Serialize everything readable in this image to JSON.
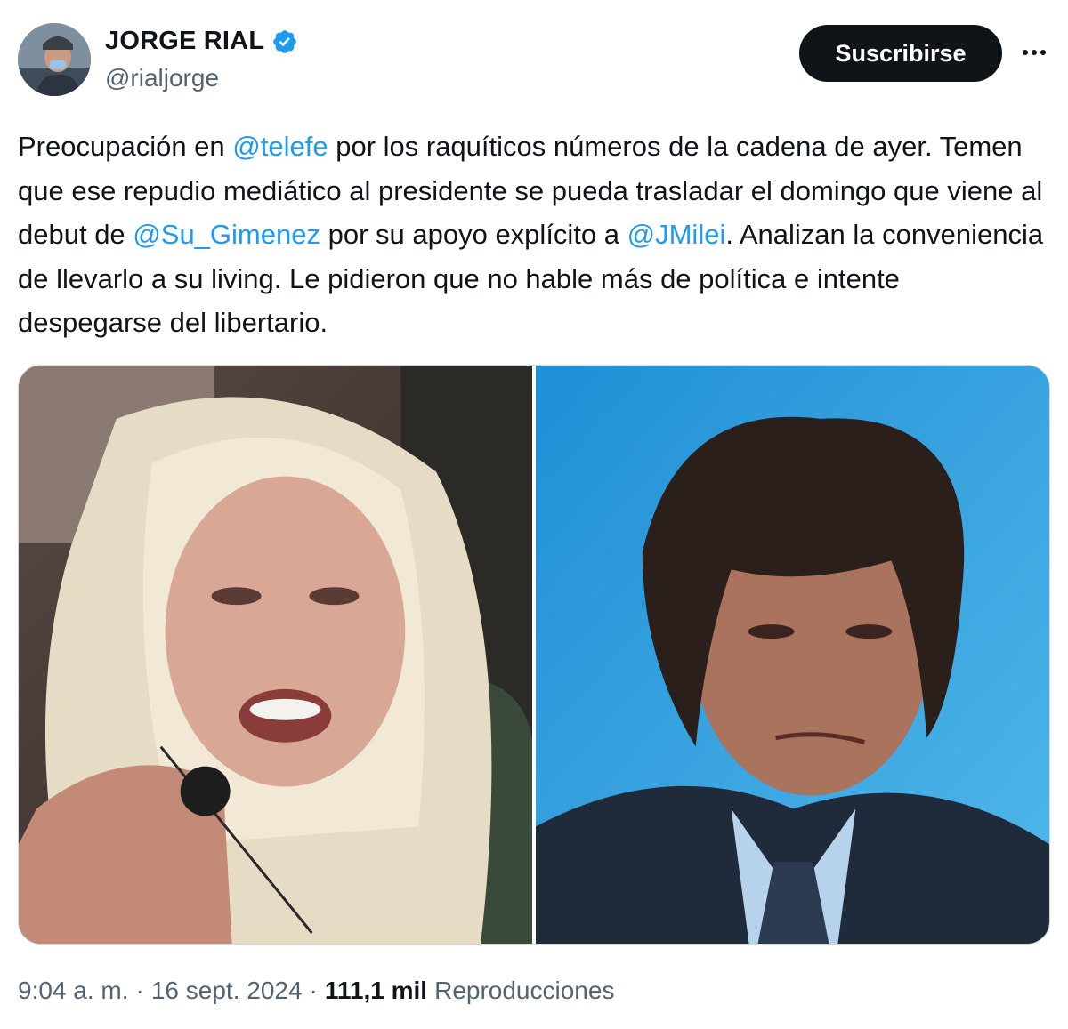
{
  "author": {
    "display_name": "JORGE RIAL",
    "handle": "@rialjorge",
    "verified": true,
    "verified_color": "#1d9bf0"
  },
  "actions": {
    "subscribe_label": "Suscribirse",
    "more_icon": "more-horizontal-icon"
  },
  "tweet": {
    "text_segments": [
      {
        "type": "text",
        "value": "Preocupación en "
      },
      {
        "type": "mention",
        "value": "@telefe"
      },
      {
        "type": "text",
        "value": " por los raquíticos números de la cadena de ayer. Temen que ese repudio mediático al presidente se pueda trasladar el domingo que viene al debut de "
      },
      {
        "type": "mention",
        "value": "@Su_Gimenez"
      },
      {
        "type": "text",
        "value": " por su apoyo explícito a "
      },
      {
        "type": "mention",
        "value": "@JMilei"
      },
      {
        "type": "text",
        "value": ". Analizan la conveniencia de llevarlo a su living. Le pidieron que no hable más de política e intente despegarse del libertario."
      }
    ],
    "mention_color": "#1d9bf0"
  },
  "meta": {
    "time": "9:04 a. m.",
    "date": "16 sept. 2024",
    "views_count": "111,1 mil",
    "views_label": "Reproducciones",
    "separator": "·"
  }
}
